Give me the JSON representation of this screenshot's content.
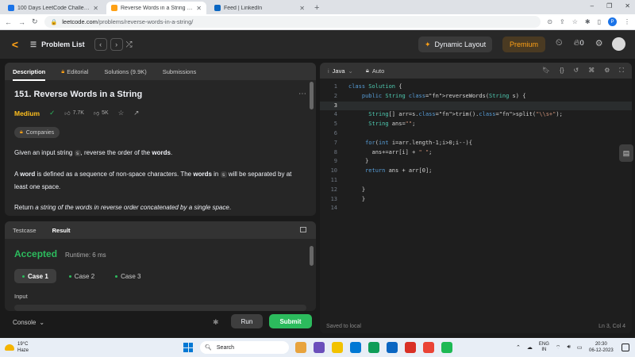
{
  "browser": {
    "tabs": [
      {
        "title": "100 Days LeetCode Challenge - ...",
        "active": false,
        "favicon_color": "#1a73e8"
      },
      {
        "title": "Reverse Words in a String - LeetC...",
        "active": true,
        "favicon_color": "#ffa116"
      },
      {
        "title": "Feed | LinkedIn",
        "active": false,
        "favicon_color": "#0a66c2"
      }
    ],
    "new_tab": "+",
    "url_host": "leetcode.com",
    "url_path": "/problems/reverse-words-in-a-string/",
    "profile_initial": "P",
    "window_controls": [
      "–",
      "❐",
      "✕"
    ]
  },
  "lc_nav": {
    "problem_list_label": "Problem List",
    "dynamic_layout_label": "Dynamic Layout",
    "premium_label": "Premium",
    "streak_count": "0"
  },
  "description": {
    "tabs": [
      "Description",
      "Editorial",
      "Solutions (9.9K)",
      "Submissions"
    ],
    "title": "151. Reverse Words in a String",
    "difficulty": "Medium",
    "likes": "7.7K",
    "dislikes": "5K",
    "companies_label": "Companies",
    "para1_pre": "Given an input string",
    "para1_code": "s",
    "para1_mid": ", reverse the order of the",
    "para1_bold": "words",
    "para1_end": ".",
    "para2_pre": "A",
    "para2_bold1": "word",
    "para2_mid": "is defined as a sequence of non-space characters. The",
    "para2_bold2": "words",
    "para2_in": "in",
    "para2_code": "s",
    "para2_end": "will be separated by at least one space.",
    "para3_pre": "Return",
    "para3_italic": "a string of the words in reverse order concatenated by a single space",
    "para3_end": "."
  },
  "result": {
    "tabs": [
      "Testcase",
      "Result"
    ],
    "status": "Accepted",
    "runtime": "Runtime: 6 ms",
    "cases": [
      "Case 1",
      "Case 2",
      "Case 3"
    ],
    "input_label": "Input"
  },
  "console_bar": {
    "console_label": "Console",
    "run_label": "Run",
    "submit_label": "Submit"
  },
  "editor": {
    "language": "Java",
    "autosave": "Auto",
    "status_left": "Saved to local",
    "status_right": "Ln 3, Col 4",
    "current_line": 3,
    "lines": [
      "class Solution {",
      "    public String reverseWords(String s) {",
      "",
      "      String[] arr=s.trim().split(\"\\\\s+\");",
      "      String ans=\"\";",
      "",
      "     for(int i=arr.length-1;i>0;i--){",
      "       ans+=arr[i] + \" \";",
      "     }",
      "     return ans + arr[0];",
      "",
      "    }",
      "    }",
      ""
    ]
  },
  "taskbar": {
    "temp": "19°C",
    "weather": "Haze",
    "search_placeholder": "Search",
    "lang_top": "ENG",
    "lang_bottom": "IN",
    "time": "20:30",
    "date": "06-12-2023",
    "app_colors": [
      "#e8a33d",
      "#6b4fbb",
      "#f2c200",
      "#0078d4",
      "#0f9d58",
      "#0a66c2",
      "#d93025",
      "#ea4335",
      "#1db954"
    ]
  }
}
